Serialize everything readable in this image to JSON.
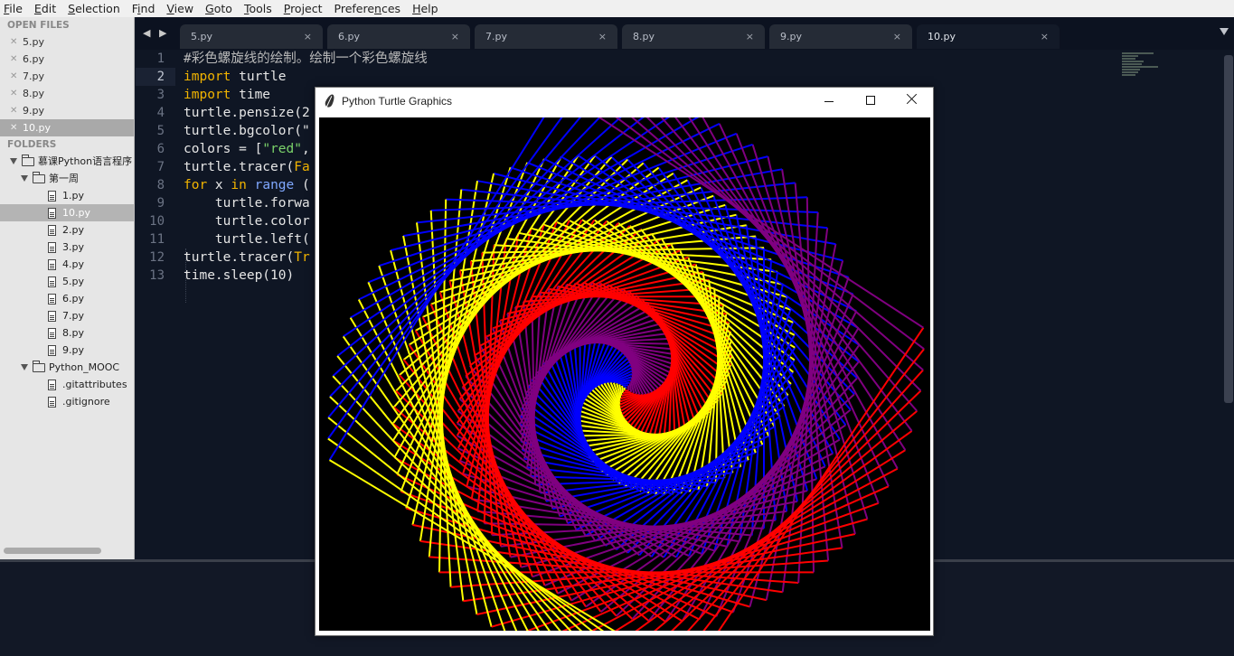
{
  "menu": [
    {
      "pre": "",
      "ul": "F",
      "post": "ile"
    },
    {
      "pre": "",
      "ul": "E",
      "post": "dit"
    },
    {
      "pre": "",
      "ul": "S",
      "post": "election"
    },
    {
      "pre": "F",
      "ul": "i",
      "post": "nd"
    },
    {
      "pre": "",
      "ul": "V",
      "post": "iew"
    },
    {
      "pre": "",
      "ul": "G",
      "post": "oto"
    },
    {
      "pre": "",
      "ul": "T",
      "post": "ools"
    },
    {
      "pre": "",
      "ul": "P",
      "post": "roject"
    },
    {
      "pre": "Prefere",
      "ul": "n",
      "post": "ces"
    },
    {
      "pre": "",
      "ul": "H",
      "post": "elp"
    }
  ],
  "sidebar": {
    "open_files_header": "OPEN FILES",
    "open_files": [
      "5.py",
      "6.py",
      "7.py",
      "8.py",
      "9.py",
      "10.py"
    ],
    "active_open_file": "10.py",
    "folders_header": "FOLDERS",
    "root_folder": "慕课Python语言程序",
    "week_folder": "第一周",
    "week_files": [
      "1.py",
      "10.py",
      "2.py",
      "3.py",
      "4.py",
      "5.py",
      "6.py",
      "7.py",
      "8.py",
      "9.py"
    ],
    "active_tree_file": "10.py",
    "mooc_folder": "Python_MOOC",
    "mooc_files": [
      ".gitattributes",
      ".gitignore"
    ]
  },
  "tabs": [
    {
      "label": "5.py",
      "close": "×"
    },
    {
      "label": "6.py",
      "close": "×"
    },
    {
      "label": "7.py",
      "close": "×"
    },
    {
      "label": "8.py",
      "close": "×"
    },
    {
      "label": "9.py",
      "close": "×"
    },
    {
      "label": "10.py",
      "close": "×"
    }
  ],
  "tab_nav": "◀ ▶",
  "active_tab": "10.py",
  "editor": {
    "line_numbers": [
      "1",
      "2",
      "3",
      "4",
      "5",
      "6",
      "7",
      "8",
      "9",
      "10",
      "11",
      "12",
      "13"
    ],
    "current_line": 2,
    "lines": [
      [
        {
          "t": "#彩色螺旋线的绘制。绘制一个彩色螺旋线",
          "c": "comment"
        }
      ],
      [
        {
          "t": "import",
          "c": "kw"
        },
        {
          "t": " turtle",
          "c": "plain"
        }
      ],
      [
        {
          "t": "import",
          "c": "kw"
        },
        {
          "t": " time",
          "c": "plain"
        }
      ],
      [
        {
          "t": "turtle.pensize(2",
          "c": "plain"
        }
      ],
      [
        {
          "t": "turtle.bgcolor(\"",
          "c": "plain"
        }
      ],
      [
        {
          "t": "colors = [",
          "c": "plain"
        },
        {
          "t": "\"red\"",
          "c": "str"
        },
        {
          "t": ",",
          "c": "plain"
        }
      ],
      [
        {
          "t": "turtle.tracer(",
          "c": "plain"
        },
        {
          "t": "Fa",
          "c": "kw"
        }
      ],
      [
        {
          "t": "for",
          "c": "kw"
        },
        {
          "t": " x ",
          "c": "plain"
        },
        {
          "t": "in",
          "c": "kw"
        },
        {
          "t": " ",
          "c": "plain"
        },
        {
          "t": "range",
          "c": "fn"
        },
        {
          "t": " (",
          "c": "plain"
        }
      ],
      [
        {
          "t": "    turtle.forwa",
          "c": "plain"
        }
      ],
      [
        {
          "t": "    turtle.color",
          "c": "plain"
        }
      ],
      [
        {
          "t": "    turtle.left(",
          "c": "plain"
        }
      ],
      [
        {
          "t": "turtle.tracer(",
          "c": "plain"
        },
        {
          "t": "Tr",
          "c": "kw"
        }
      ],
      [
        {
          "t": "time.sleep(10)",
          "c": "plain"
        }
      ]
    ]
  },
  "turtle_window": {
    "title": "Python Turtle Graphics",
    "background": "#000000",
    "colors": [
      "#ff0000",
      "#800080",
      "#0000ff",
      "#ffff00"
    ]
  }
}
